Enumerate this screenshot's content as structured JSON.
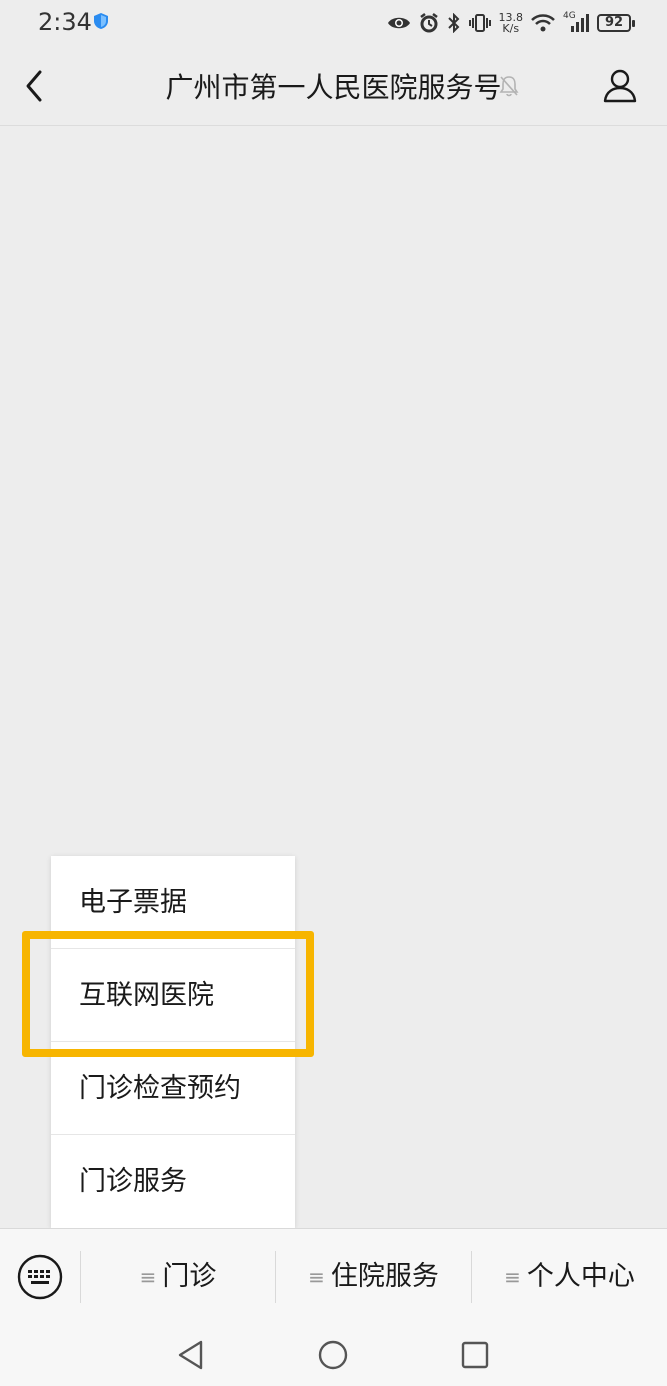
{
  "status_bar": {
    "time": "2:34",
    "net_speed_value": "13.8",
    "net_speed_unit": "K/s",
    "network_type": "4G",
    "battery": "92"
  },
  "nav": {
    "title": "广州市第一人民医院服务号"
  },
  "submenu": {
    "items": [
      {
        "label": "电子票据"
      },
      {
        "label": "互联网医院"
      },
      {
        "label": "门诊检查预约"
      },
      {
        "label": "门诊服务"
      }
    ],
    "highlighted_index": 1,
    "highlight_color": "#f7b500"
  },
  "menu_bar": {
    "tabs": [
      {
        "label": "门诊"
      },
      {
        "label": "住院服务"
      },
      {
        "label": "个人中心"
      }
    ]
  }
}
